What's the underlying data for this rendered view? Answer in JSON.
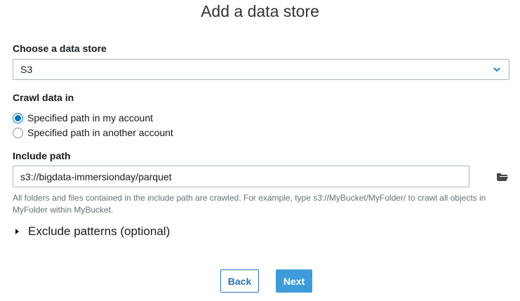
{
  "page": {
    "title": "Add a data store"
  },
  "data_store": {
    "label": "Choose a data store",
    "selected": "S3",
    "icon": "chevron-down-icon"
  },
  "crawl": {
    "label": "Crawl data in",
    "options": [
      {
        "label": "Specified path in my account",
        "checked": true
      },
      {
        "label": "Specified path in another account",
        "checked": false
      }
    ]
  },
  "include_path": {
    "label": "Include path",
    "value": "s3://bigdata-immersionday/parquet",
    "browse_icon": "folder-open-icon",
    "hint": "All folders and files contained in the include path are crawled. For example, type s3://MyBucket/MyFolder/ to crawl all objects in MyFolder within MyBucket."
  },
  "exclude": {
    "label": "Exclude patterns (optional)",
    "icon": "caret-right-icon"
  },
  "actions": {
    "back_label": "Back",
    "next_label": "Next"
  },
  "colors": {
    "accent": "#0073bb",
    "primary_button": "#3e9bd9",
    "link_button": "#2a73b8"
  }
}
